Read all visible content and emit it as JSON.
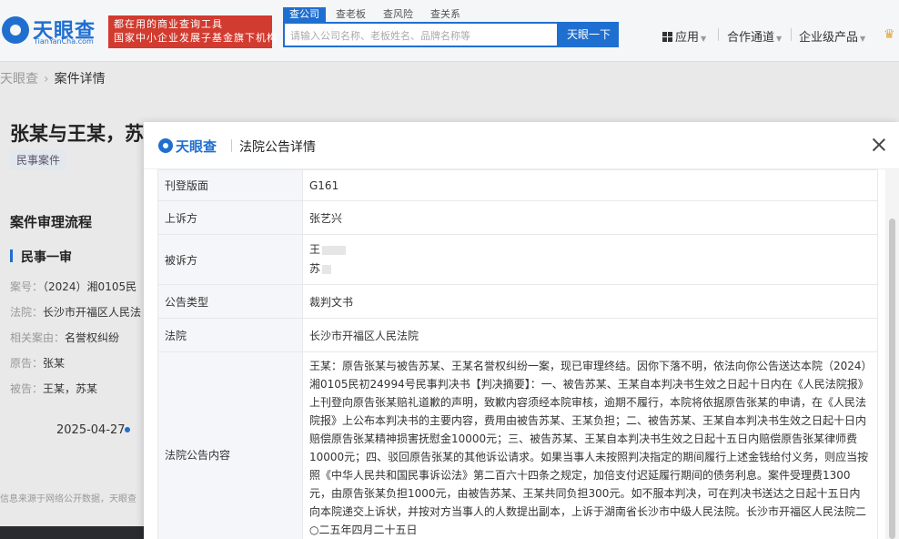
{
  "header": {
    "logo_cn": "天眼查",
    "logo_en": "TianYanCha.com",
    "slogan_line1": "都在用的商业查询工具",
    "slogan_line2": "国家中小企业发展子基金旗下机构",
    "search_tabs": [
      "查公司",
      "查老板",
      "查风险",
      "查关系"
    ],
    "search_placeholder": "请输入公司名称、老板姓名、品牌名称等",
    "search_button": "天眼一下",
    "nav": [
      "应用",
      "合作通道",
      "企业级产品"
    ]
  },
  "breadcrumb": {
    "home": "天眼查",
    "current": "案件详情"
  },
  "case": {
    "title": "张某与王某，苏",
    "tag": "民事案件",
    "section_title": "案件审理流程",
    "stage_title": "民事一审",
    "fields": [
      {
        "label": "案号：",
        "value": "（2024）湘0105民"
      },
      {
        "label": "法院：",
        "value": "长沙市开福区人民法"
      },
      {
        "label": "相关案由：",
        "value": "名誉权纠纷"
      },
      {
        "label": "原告：",
        "value": "张某"
      },
      {
        "label": "被告：",
        "value": "王某，苏某"
      }
    ],
    "timeline_date": "2025-04-27",
    "source_note": "信息来源于网络公开数据，天眼查"
  },
  "modal": {
    "logo_text": "天眼查",
    "title": "法院公告详情",
    "rows": [
      {
        "label": "刊登版面",
        "value": "G161"
      },
      {
        "label": "上诉方",
        "value": "张艺兴"
      },
      {
        "label": "被诉方",
        "value_lines": [
          "王",
          "苏"
        ]
      },
      {
        "label": "公告类型",
        "value": "裁判文书"
      },
      {
        "label": "法院",
        "value": "长沙市开福区人民法院"
      },
      {
        "label": "法院公告内容",
        "value": "王某：原告张某与被告苏某、王某名誉权纠纷一案，现已审理终结。因你下落不明，依法向你公告送达本院（2024）湘0105民初24994号民事判决书【判决摘要】：一、被告苏某、王某自本判决书生效之日起十日内在《人民法院报》上刊登向原告张某赔礼道歉的声明，致歉内容须经本院审核，逾期不履行，本院将依据原告张某的申请，在《人民法院报》上公布本判决书的主要内容，费用由被告苏某、王某负担；二、被告苏某、王某自本判决书生效之日起十日内赔偿原告张某精神损害抚慰金10000元；三、被告苏某、王某自本判决书生效之日起十五日内赔偿原告张某律师费10000元；四、驳回原告张某的其他诉讼请求。如果当事人未按照判决指定的期间履行上述金钱给付义务，则应当按照《中华人民共和国民事诉讼法》第二百六十四条之规定，加倍支付迟延履行期间的债务利息。案件受理费1300元，由原告张某负担1000元，由被告苏某、王某共同负担300元。如不服本判决，可在判决书送达之日起十五日内向本院递交上诉状，并按对方当事人的人数提出副本，上诉于湖南省长沙市中级人民法院。长沙市开福区人民法院二○二五年四月二十五日"
      }
    ]
  }
}
